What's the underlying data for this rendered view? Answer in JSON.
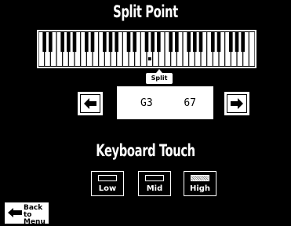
{
  "screen": {
    "title": "Split Point",
    "section_title": "Keyboard Touch"
  },
  "keyboard": {
    "white_key_count": 36,
    "split_indicator_label": "Split"
  },
  "split_value": {
    "note": "G3",
    "number": "67"
  },
  "touch": {
    "options": [
      {
        "label": "Low",
        "selected": false
      },
      {
        "label": "Mid",
        "selected": false
      },
      {
        "label": "High",
        "selected": true
      }
    ]
  },
  "back_button": {
    "label": "Back to Menu"
  },
  "colors": {
    "background": "#000000",
    "foreground": "#ffffff"
  }
}
